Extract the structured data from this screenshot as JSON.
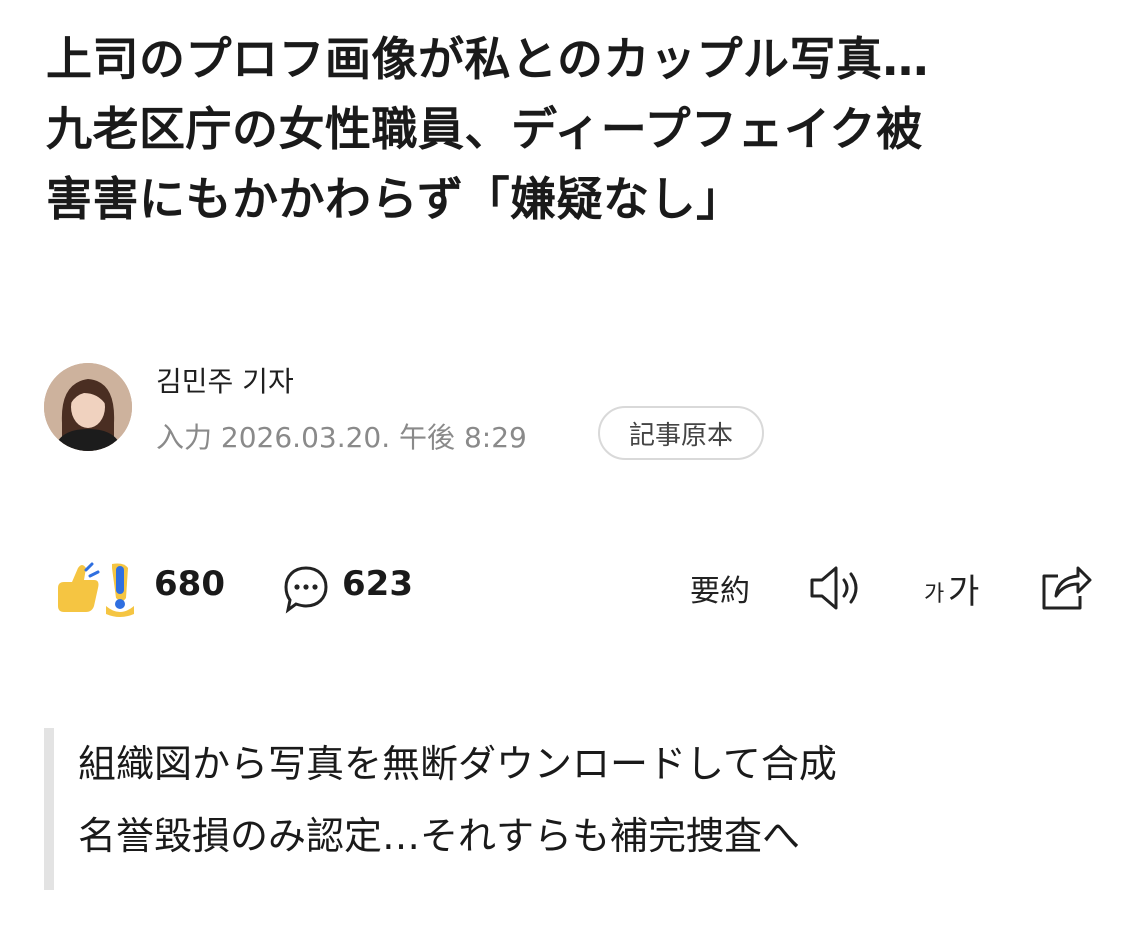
{
  "article": {
    "headline_lines": [
      "上司のプロフ画像が私とのカップル写真…",
      "九老区庁の女性職員、ディープフェイク被",
      "害害にもかかわらず「嫌疑なし」"
    ],
    "reporter": "김민주 기자",
    "input_label": "入力",
    "published": "2026.03.20. 午後 8:29",
    "original_button": "記事原本",
    "subtitle_lines": [
      "組織図から写真を無断ダウンロードして合成",
      "名誉毀損のみ認定…それすらも補完捜査へ"
    ]
  },
  "stats": {
    "reactions": "680",
    "comments": "623"
  },
  "toolbar": {
    "summary_label": "要約",
    "font_size_label_small": "가",
    "font_size_label_large": "가"
  },
  "icons": {
    "reaction": "thumbs-up-exclamation-icon",
    "comment": "speech-bubble-icon",
    "listen": "speaker-icon",
    "font_size": "font-size-icon",
    "share": "share-icon"
  },
  "colors": {
    "reaction_yellow": "#f5c542",
    "reaction_blue": "#2f6fe0",
    "border_gray": "#d9d9d9",
    "meta_gray": "#8a8a8a"
  }
}
